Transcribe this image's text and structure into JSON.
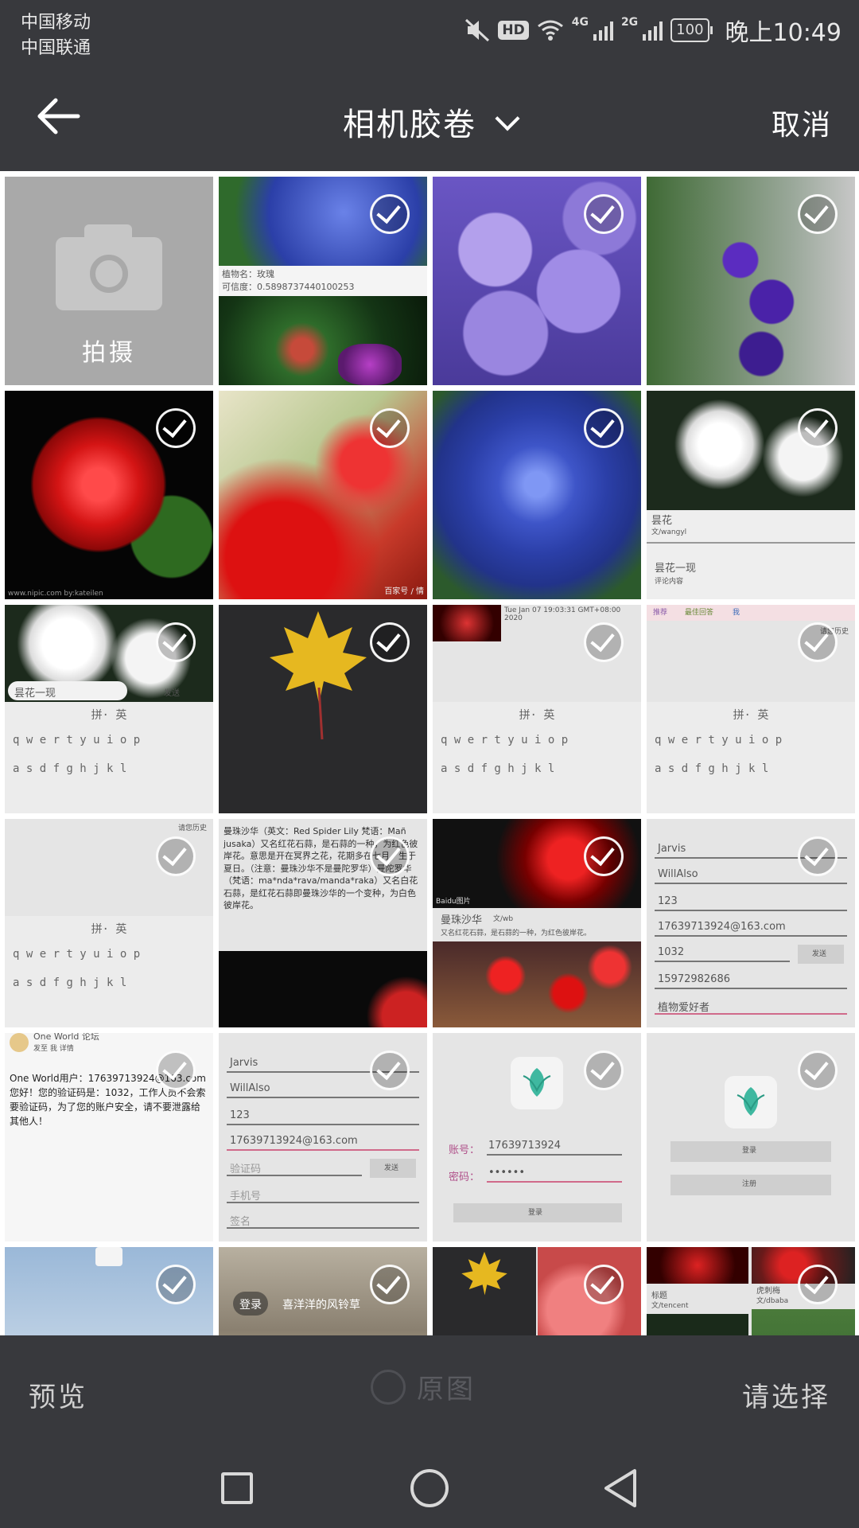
{
  "status_bar": {
    "carrier_1": "中国移动",
    "carrier_2": "中国联通",
    "hd_label": "HD",
    "net_1": "4G",
    "net_2": "2G",
    "battery": "100",
    "time": "晚上10:49"
  },
  "header": {
    "title": "相机胶卷",
    "cancel_label": "取消"
  },
  "camera_tile": {
    "label": "拍摄"
  },
  "grid": {
    "tile_notes": {
      "t2_text1": "植物名：玫瑰",
      "t2_text2": "可信度：0.5898737440100253",
      "t5_caption": "www.nipic.com  by:kateilen",
      "t6_caption": "百家号 / 情",
      "t8_title": "昙花",
      "t8_author": "文/wangyl",
      "t8_post": "昙花一现",
      "t8_post_sub": "评论内容",
      "t9_input": "昙花一现",
      "t9_send": "发送",
      "t11_date": "Tue Jan 07 19:03:31 GMT+08:00 2020",
      "t12_tab1": "推荐",
      "t12_tab2": "最佳回答",
      "t12_tab3": "我",
      "t12_hint": "请您历史",
      "t13_hint": "请您历史",
      "t14_article": "曼珠沙华（英文：Red Spider Lily 梵语：Mañ jusaka）又名红花石蒜，是石蒜的一种，为红色彼岸花。意思是开在冥界之花，花期多在七月，生于夏日。（注意：曼珠沙华不是曼陀罗华）曼陀罗华（梵语：ma*nda*rava/manda*raka）又名白花石蒜，是红花石蒜即曼珠沙华的一个变种，为白色彼岸花。",
      "t15_title": "曼珠沙华",
      "t15_author": "文/wb",
      "t15_body": "又名红花石蒜，是石蒜的一种，为红色彼岸花。",
      "t15_watermark": "Baidu图片",
      "t16_f1": "Jarvis",
      "t16_f2": "WillAlso",
      "t16_f3": "123",
      "t16_f4": "17639713924@163.com",
      "t16_f5": "1032",
      "t16_send": "发送",
      "t16_f6": "15972982686",
      "t16_f7": "植物爱好者",
      "t17_title": "One World 论坛",
      "t17_sub": "发至 我 详情",
      "t17_body": "One World用户：17639713924@163.com 您好！您的验证码是：1032，工作人员不会索要验证码，为了您的账户安全，请不要泄露给其他人！",
      "t18_f1": "Jarvis",
      "t18_f2": "WillAlso",
      "t18_f3": "123",
      "t18_f4": "17639713924@163.com",
      "t18_f5": "验证码",
      "t18_send": "发送",
      "t18_f6": "手机号",
      "t18_f7": "签名",
      "t19_account_label": "账号：",
      "t19_account": "17639713924",
      "t19_pass_label": "密码：",
      "t19_pass": "••••••",
      "t19_login": "登录",
      "t20_login": "登录",
      "t20_register": "注册",
      "t22_login": "登录",
      "t22_caption": "喜洋洋的风铃草",
      "t24_title": "标题",
      "t24_author": "文/tencent",
      "t24_name": "虎刺梅",
      "t24_author2": "文/dbaba"
    },
    "keyboard": {
      "toolbar": "拼· 英",
      "row1": "q w e r t y u i o p",
      "row2": "a s d f g h j k l"
    }
  },
  "bottom_bar": {
    "preview_label": "预览",
    "original_label": "原图",
    "select_label": "请选择"
  }
}
